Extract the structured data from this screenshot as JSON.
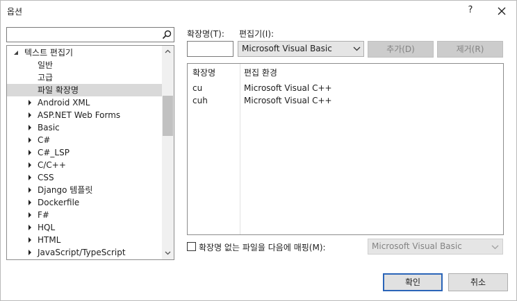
{
  "window": {
    "title": "옵션",
    "help_label": "?"
  },
  "search": {
    "value": "",
    "placeholder": ""
  },
  "tree": {
    "rows": [
      {
        "label": "텍스트 편집기",
        "state": "expanded"
      },
      {
        "label": "일반",
        "state": "leaf"
      },
      {
        "label": "고급",
        "state": "leaf"
      },
      {
        "label": "파일 확장명",
        "state": "leaf",
        "selected": true
      },
      {
        "label": "Android XML",
        "state": "collapsed"
      },
      {
        "label": "ASP.NET Web Forms",
        "state": "collapsed"
      },
      {
        "label": "Basic",
        "state": "collapsed"
      },
      {
        "label": "C#",
        "state": "collapsed"
      },
      {
        "label": "C#_LSP",
        "state": "collapsed"
      },
      {
        "label": "C/C++",
        "state": "collapsed"
      },
      {
        "label": "CSS",
        "state": "collapsed"
      },
      {
        "label": "Django 템플릿",
        "state": "collapsed"
      },
      {
        "label": "Dockerfile",
        "state": "collapsed"
      },
      {
        "label": "F#",
        "state": "collapsed"
      },
      {
        "label": "HQL",
        "state": "collapsed"
      },
      {
        "label": "HTML",
        "state": "collapsed"
      },
      {
        "label": "JavaScript/TypeScript",
        "state": "collapsed"
      }
    ]
  },
  "form": {
    "extension_label": "확장명(T):",
    "extension_value": "",
    "editor_label": "편집기(I):",
    "editor_selected": "Microsoft Visual Basic",
    "add_button": "추가(D)",
    "remove_button": "제거(R)"
  },
  "table": {
    "headers": [
      "확장명",
      "편집 환경"
    ],
    "rows": [
      {
        "ext": "cu",
        "editor": "Microsoft Visual C++"
      },
      {
        "ext": "cuh",
        "editor": "Microsoft Visual C++"
      }
    ]
  },
  "mapping": {
    "checkbox_label": "확장명 없는 파일을 다음에 매핑(M):",
    "checked": false,
    "editor_selected": "Microsoft Visual Basic"
  },
  "footer": {
    "ok_button": "확인",
    "cancel_button": "취소"
  },
  "colors": {
    "selection_bg": "#d9d9d9",
    "default_button_border": "#2a64b8",
    "disabled_text": "#838383"
  }
}
